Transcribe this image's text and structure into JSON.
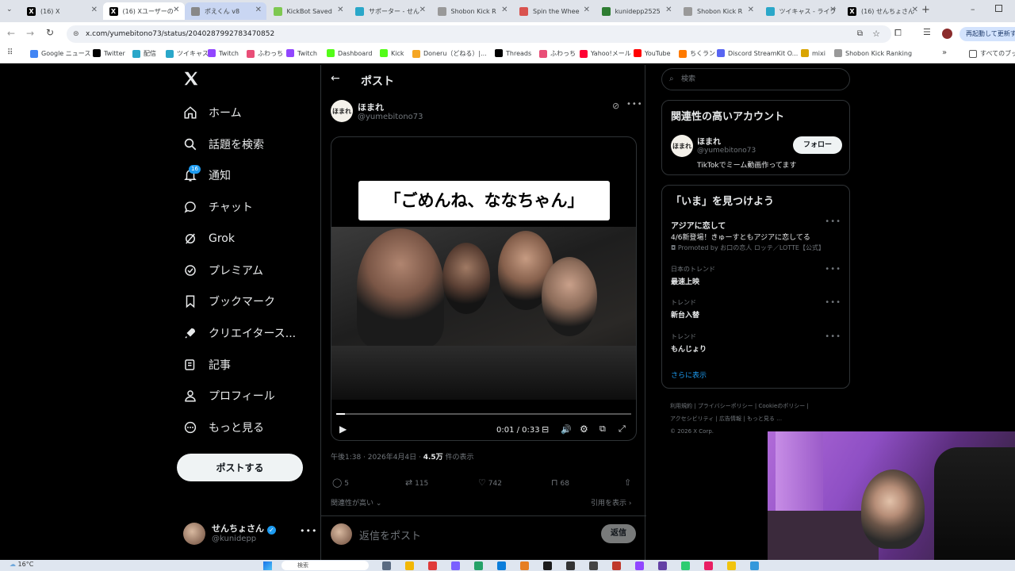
{
  "browser": {
    "tabs": [
      {
        "title": "(16) X",
        "fav": "X",
        "color": "#000"
      },
      {
        "title": "(16) Xユーザーの",
        "fav": "X",
        "color": "#000"
      },
      {
        "title": "ポえくん v8",
        "fav": "",
        "color": "#888"
      },
      {
        "title": "KickBot Saved",
        "fav": "",
        "color": "#7ec850"
      },
      {
        "title": "サポーター - せん",
        "fav": "",
        "color": "#2aa7c9"
      },
      {
        "title": "Shobon Kick R",
        "fav": "",
        "color": "#999"
      },
      {
        "title": "Spin the Whee",
        "fav": "",
        "color": "#d9534f"
      },
      {
        "title": "kunidepp2525",
        "fav": "",
        "color": "#2e7d32"
      },
      {
        "title": "Shobon Kick R",
        "fav": "",
        "color": "#999"
      },
      {
        "title": "ツイキャス - ライブ",
        "fav": "",
        "color": "#2aa7c9"
      },
      {
        "title": "(16) せんちょさん",
        "fav": "X",
        "color": "#000"
      }
    ],
    "url": "x.com/yumebitono73/status/2040287992783470852",
    "restart_label": "再起動して更新する",
    "bookmarks": [
      {
        "label": "Google ニュース",
        "color": "#4285f4"
      },
      {
        "label": "Twitter",
        "color": "#000"
      },
      {
        "label": "配信",
        "color": "#2aa7c9"
      },
      {
        "label": "ツイキャス",
        "color": "#2aa7c9"
      },
      {
        "label": "Twitch",
        "color": "#9146ff"
      },
      {
        "label": "ふわっち",
        "color": "#e94e77"
      },
      {
        "label": "Twitch",
        "color": "#9146ff"
      },
      {
        "label": "Dashboard",
        "color": "#53fc18"
      },
      {
        "label": "Kick",
        "color": "#53fc18"
      },
      {
        "label": "Doneru（どねる）|...",
        "color": "#f5a623"
      },
      {
        "label": "Threads",
        "color": "#000"
      },
      {
        "label": "ふわっち",
        "color": "#e94e77"
      },
      {
        "label": "Yahoo!メール",
        "color": "#ff0033"
      },
      {
        "label": "YouTube",
        "color": "#ff0000"
      },
      {
        "label": "ちくラン",
        "color": "#ff7a00"
      },
      {
        "label": "Discord StreamKit O...",
        "color": "#5865f2"
      },
      {
        "label": "mixi",
        "color": "#d9a400"
      },
      {
        "label": "Shobon Kick Ranking",
        "color": "#999"
      }
    ],
    "all_bookmarks_label": "すべてのブック"
  },
  "nav": {
    "logo": "X",
    "items": [
      {
        "label": "ホーム",
        "icon": "home-icon"
      },
      {
        "label": "話題を検索",
        "icon": "search-icon"
      },
      {
        "label": "通知",
        "icon": "bell-icon",
        "badge": "16"
      },
      {
        "label": "チャット",
        "icon": "chat-icon"
      },
      {
        "label": "Grok",
        "icon": "grok-icon"
      },
      {
        "label": "プレミアム",
        "icon": "premium-icon"
      },
      {
        "label": "ブックマーク",
        "icon": "bookmark-icon"
      },
      {
        "label": "クリエイタース...",
        "icon": "rocket-icon"
      },
      {
        "label": "記事",
        "icon": "article-icon"
      },
      {
        "label": "プロフィール",
        "icon": "profile-icon"
      },
      {
        "label": "もっと見る",
        "icon": "more-circle-icon"
      }
    ],
    "post_button": "ポストする",
    "account": {
      "name": "せんちょさん",
      "handle": "@kunidepp"
    }
  },
  "post": {
    "header_title": "ポスト",
    "author_name": "ほまれ",
    "author_handle": "@yumebitono73",
    "avatar_text": "ほまれ",
    "video_caption": "「ごめんね、ななちゃん」",
    "video_time": "0:01 / 0:33",
    "video_progress": 0.03,
    "timestamp": "午後1:38 · 2026年4月4日 · ",
    "views_count": "4.5万",
    "views_label": " 件の表示",
    "replies": "5",
    "reposts": "115",
    "likes": "742",
    "bookmarks": "68",
    "relevance_label": "関連性が高い",
    "quotes_label": "引用を表示",
    "reply_placeholder": "返信をポスト",
    "reply_button": "返信"
  },
  "sidebar": {
    "search_placeholder": "検索",
    "related_title": "関連性の高いアカウント",
    "related_account": {
      "name": "ほまれ",
      "handle": "@yumebitono73",
      "bio": "TikTokでミーム動画作ってます",
      "follow_label": "フォロー"
    },
    "explore_title": "「いま」を見つけよう",
    "trends": [
      {
        "context": "",
        "title": "アジアに恋して",
        "desc": "4/6新登場！きゅーすともアジアに恋してる",
        "promo": "Promoted by お口の恋人 ロッテ／LOTTE【公式】"
      },
      {
        "context": "日本のトレンド",
        "title": "最速上映"
      },
      {
        "context": "トレンド",
        "title": "新台入替"
      },
      {
        "context": "トレンド",
        "title": "もんじょり"
      }
    ],
    "show_more": "さらに表示",
    "footer": [
      "利用規約",
      "プライバシーポリシー",
      "Cookieのポリシー",
      "アクセシビリティ",
      "広告情報",
      "もっと見る …",
      "© 2026 X Corp."
    ]
  },
  "taskbar": {
    "temperature": "16°C",
    "search_label": "検索"
  }
}
